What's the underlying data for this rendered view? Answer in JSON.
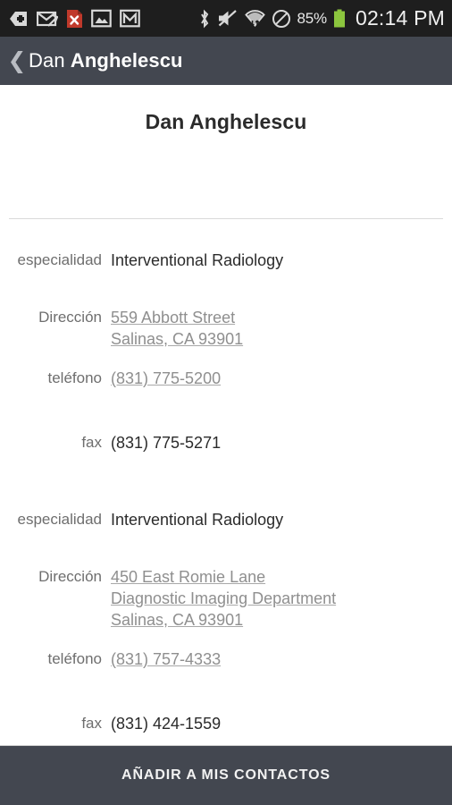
{
  "statusbar": {
    "icons_left": [
      {
        "name": "download-arrow-icon",
        "label": "download"
      },
      {
        "name": "mail-muted-icon",
        "label": "email-disabled"
      },
      {
        "name": "document-error-icon",
        "label": "file-error",
        "color": "#c0392b"
      },
      {
        "name": "image-icon",
        "label": "screenshot"
      },
      {
        "name": "gmail-icon",
        "label": "gmail"
      }
    ],
    "icons_right": [
      {
        "name": "bluetooth-icon",
        "label": "bluetooth"
      },
      {
        "name": "volume-muted-icon",
        "label": "sound-off"
      },
      {
        "name": "wifi-icon",
        "label": "wifi"
      },
      {
        "name": "do-not-disturb-icon",
        "label": "dnd"
      }
    ],
    "battery_percent": "85%",
    "battery_color": "#8cc63e",
    "time": "02:14 PM"
  },
  "actionbar": {
    "back_icon": "chevron-left-icon",
    "title_first": "Dan ",
    "title_last": "Anghelescu",
    "background": "#434750"
  },
  "header": {
    "person_name": "Dan Anghelescu"
  },
  "details": [
    {
      "label": "especialidad",
      "type": "text",
      "lines": [
        "Interventional Radiology"
      ]
    },
    {
      "label": "Dirección",
      "type": "link",
      "lines": [
        "559 Abbott Street",
        "Salinas, CA 93901"
      ]
    },
    {
      "label": "teléfono",
      "type": "link",
      "lines": [
        "(831) 775-5200"
      ]
    },
    {
      "label": "fax",
      "type": "text",
      "lines": [
        "(831) 775-5271"
      ]
    },
    {
      "label": "especialidad",
      "type": "text",
      "lines": [
        "Interventional Radiology"
      ]
    },
    {
      "label": "Dirección",
      "type": "link",
      "lines": [
        "450 East Romie Lane",
        "Diagnostic Imaging Department",
        "Salinas, CA 93901"
      ]
    },
    {
      "label": "teléfono",
      "type": "link",
      "lines": [
        "(831) 757-4333"
      ]
    },
    {
      "label": "fax",
      "type": "text",
      "lines": [
        "(831) 424-1559"
      ]
    }
  ],
  "footer": {
    "button_label": "AÑADIR A MIS CONTACTOS"
  }
}
